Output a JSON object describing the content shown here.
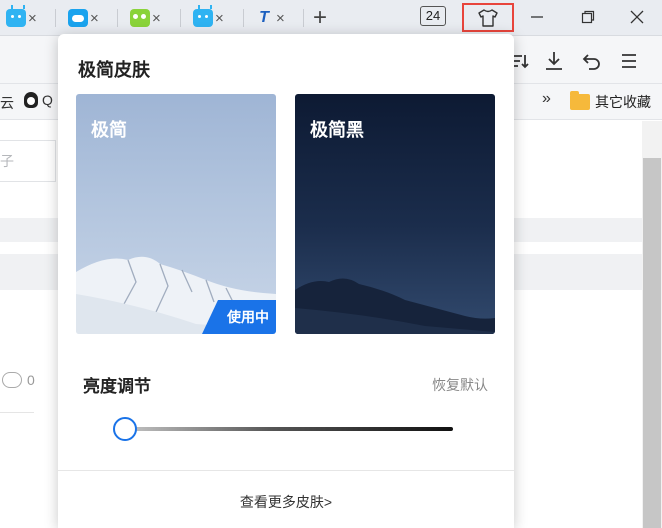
{
  "tabs": [
    {
      "icon": "tv-icon",
      "close": "×"
    },
    {
      "icon": "cloud-icon",
      "close": "×"
    },
    {
      "icon": "owl-icon",
      "close": "×"
    },
    {
      "icon": "tv-icon",
      "close": "×"
    },
    {
      "icon": "tp-logo-icon",
      "label": "T",
      "close": "×"
    }
  ],
  "new_tab": "+",
  "tab_counter": "24",
  "toolbar": {
    "icons": [
      "sort-icon",
      "download-icon",
      "undo-icon",
      "menu-icon"
    ]
  },
  "bookmarks": {
    "left_fragment": "云",
    "qq_fragment": "Q",
    "more": "»",
    "other_folder": "其它收藏"
  },
  "page": {
    "input_fragment": "子",
    "comment_count": "0"
  },
  "skin_panel": {
    "title": "极简皮肤",
    "skins": [
      {
        "name": "极简",
        "active": true,
        "badge": "使用中"
      },
      {
        "name": "极简黑",
        "active": false
      }
    ],
    "brightness_label": "亮度调节",
    "reset_label": "恢复默认",
    "brightness_value": 0.0,
    "more_link": "查看更多皮肤>"
  },
  "colors": {
    "accent": "#1a73e8",
    "highlight_border": "#e8453c",
    "tabbar_bg": "#e9ecf1"
  }
}
